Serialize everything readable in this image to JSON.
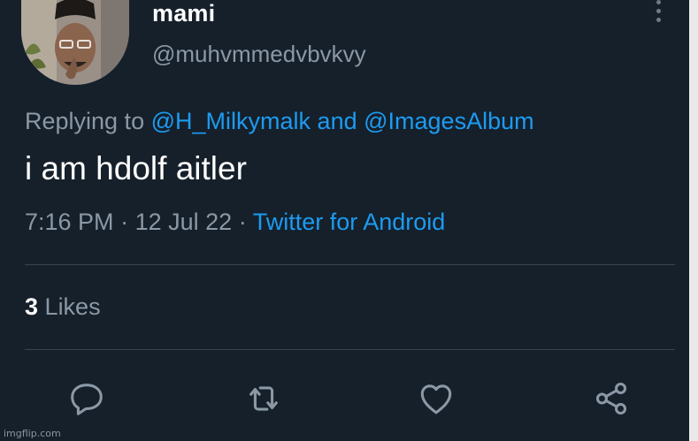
{
  "tweet": {
    "display_name": "mami",
    "handle": "@muhvmmedvbvkvy",
    "replying_prefix": "Replying to",
    "reply_to_1": "@H_Milkymalk",
    "reply_conjunction": "and",
    "reply_to_2": "@ImagesAlbum",
    "text": "i am hdolf aitler",
    "time": "7:16 PM",
    "date": "12 Jul 22",
    "separator": "·",
    "source": "Twitter for Android",
    "likes_count": "3",
    "likes_label": "Likes"
  },
  "icons": {
    "more": "more-vertical-icon",
    "reply": "reply-icon",
    "retweet": "retweet-icon",
    "like": "heart-icon",
    "share": "share-icon"
  },
  "colors": {
    "background": "#15202b",
    "secondary_text": "#8b98a5",
    "link": "#1d9bf0",
    "divider": "#38444d"
  },
  "watermark": "imgflip.com"
}
